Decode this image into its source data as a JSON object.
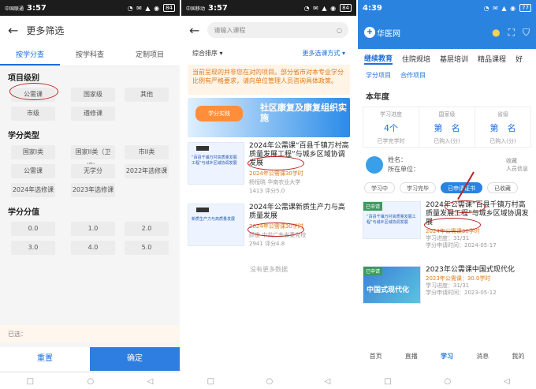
{
  "panel1": {
    "status": {
      "carrier": "中国联通",
      "time": "3:57",
      "icons": "◔ ✉ ▲ ◉",
      "battery": "84"
    },
    "title": "更多筛选",
    "tabs": [
      "按学分查",
      "按学科查",
      "定制项目"
    ],
    "sec1": "项目级别",
    "level": [
      "公需课",
      "国家级",
      "其他",
      "市级",
      "遴修课"
    ],
    "sec2": "学分类型",
    "ctype": [
      "国家I类",
      "国家II类（卫授）",
      "市II类",
      "公需课",
      "无学分",
      "2022年选修课",
      "2024年选修课",
      "2023年选修课"
    ],
    "sec3": "学分分值",
    "values": [
      "0.0",
      "1.0",
      "2.0",
      "3.0",
      "4.0",
      "5.0"
    ],
    "selected_label": "已选：",
    "reset": "重置",
    "confirm": "确定"
  },
  "panel2": {
    "status": {
      "carrier": "中国移动",
      "time": "3:57",
      "icons": "◔ ✉ ▲ ◉",
      "battery": "84"
    },
    "search_placeholder": "请输入课程",
    "sort": "综合排序 ▾",
    "more": "更多选课方式 ▾",
    "notice": "当前呈现的并非您在对的项目。部分省市对本专业学分比例有严格要求，请向单位管理人员咨询具体政策。",
    "banner_pill": "学分实践",
    "banner_text": "社区康复及康复组织实施",
    "courses": [
      {
        "title_prefix": "2024年公需课",
        "title": "“百县千镇万村高质量发展工程”与城乡区域协调发展",
        "credit": "2024年公需课30学时",
        "teacher": "杨恒晓 华南农业大学",
        "stats": "1413  评分5.0",
        "thumb": "“百县千镇万村高质量发展工程”与城乡区域协调发展"
      },
      {
        "title_prefix": "2024年公需课",
        "title": "新质生产力与高质量发展",
        "credit": "2024年公需课30学时",
        "teacher": "顾俊 中共广东省委党校",
        "stats": "2941  评分4.8",
        "thumb": "新质生产力与高质量发展"
      }
    ],
    "loadmore": "没有更多数据"
  },
  "panel3": {
    "status": {
      "carrier": "",
      "time": "4:39",
      "icons": "◔ ✉ ▲ ◉",
      "battery": "77"
    },
    "logo": "华医网",
    "tabs": [
      "继续教育",
      "住院规培",
      "基层培训",
      "精品课程",
      "好"
    ],
    "subtabs": [
      "学分项目",
      "合作项目"
    ],
    "year": "本年度",
    "stats": [
      {
        "label": "学习进度",
        "value": "4个",
        "sub": "已学完学时"
      },
      {
        "label": "国家级",
        "value": "第　名",
        "sub": "已购入(分)"
      },
      {
        "label": "省级",
        "value": "第　名",
        "sub": "已购入(分)"
      }
    ],
    "user_name": "姓名：",
    "user_unit": "所在单位：",
    "user_right": "人员信息",
    "fav": "收藏",
    "ptabs": [
      "学习中",
      "学习完毕",
      "已申请证书",
      "已收藏"
    ],
    "courses": [
      {
        "tag": "已申请",
        "title_prefix": "2024年公需课",
        "title": "“百县千镇万村高质量发展工程”与城乡区域协调发展",
        "credit": "2024年公需课30学时",
        "progress": "学习进度：31/31",
        "date": "学分申请时间：2024-05-17",
        "thumb": "“百县千镇万村高质量发展工程”与城乡区域协调发展"
      },
      {
        "tag": "已申请",
        "title_prefix": "2023年公需课",
        "title": "中国式现代化",
        "credit": "2023年公需课：30.0学时",
        "progress": "学习进度：31/31",
        "date": "学分申请时间：2023-05-12",
        "thumb": "中国式现代化"
      }
    ],
    "bnav": [
      "首页",
      "直播",
      "学习",
      "消息",
      "我的"
    ]
  },
  "nav": {
    "square": "□",
    "circle": "○",
    "back": "◁"
  }
}
